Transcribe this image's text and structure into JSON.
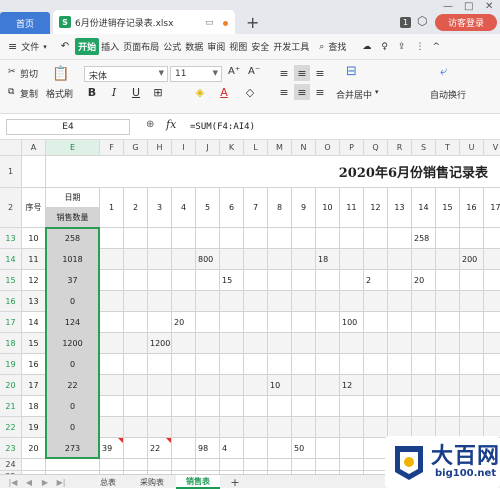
{
  "titlebar": {
    "home_tab": "首页",
    "file_tab": "6月份进销存记录表.xlsx",
    "file_icon": "S",
    "window_icon": "▭",
    "new_tab": "+",
    "badge": "1",
    "cube": "⬡",
    "login": "访客登录",
    "controls": [
      "—",
      "□",
      "✕"
    ]
  },
  "menubar": {
    "hamburger": "≡",
    "file": "文件",
    "tabs": [
      "开始",
      "插入",
      "页面布局",
      "公式",
      "数据",
      "审阅",
      "视图",
      "安全",
      "开发工具"
    ],
    "active_tab": "开始",
    "search": "查找",
    "right_icons": [
      "☁",
      "♀",
      "⇪",
      "⋮",
      "^"
    ]
  },
  "ribbon": {
    "cut": "剪切",
    "copy": "复制",
    "paste": "粘贴",
    "format_painter": "格式刷",
    "font_name": "宋体",
    "font_size": "11",
    "font_grow": "A⁺",
    "font_shrink": "A⁻",
    "bold": "B",
    "italic": "I",
    "underline": "U",
    "merge_center": "合并居中",
    "wrap_text": "自动换行",
    "align_icons": [
      "≡",
      "≡",
      "≡",
      "≡",
      "≡",
      "≡"
    ],
    "border_icon": "⊞",
    "fill_icon": "◈",
    "font_color_icon": "A",
    "eraser_icon": "◇"
  },
  "formula_bar": {
    "cell_ref": "E4",
    "zoom_icon": "⊕",
    "fx": "fx",
    "formula": "=SUM(F4:AI4)"
  },
  "columns": [
    "A",
    "E",
    "F",
    "G",
    "H",
    "I",
    "J",
    "K",
    "L",
    "M",
    "N",
    "O",
    "P",
    "Q",
    "R",
    "S",
    "T",
    "U",
    "V"
  ],
  "row_numbers": [
    "1",
    "2",
    "13",
    "14",
    "15",
    "16",
    "17",
    "18",
    "19",
    "20",
    "21",
    "22",
    "23",
    "24",
    "25"
  ],
  "sheet_title": "2020年6月份销售记录表",
  "header": {
    "seq": "序号",
    "date": "日期",
    "sales_qty": "销售数量",
    "days": [
      "1",
      "2",
      "3",
      "4",
      "5",
      "6",
      "7",
      "8",
      "9",
      "10",
      "11",
      "12",
      "13",
      "14",
      "15",
      "16",
      "17"
    ]
  },
  "rows": [
    {
      "rn": "13",
      "seq": "10",
      "total": "258",
      "cells": {
        "14": "258"
      }
    },
    {
      "rn": "14",
      "seq": "11",
      "total": "1018",
      "cells": {
        "5": "800",
        "10": "18",
        "16": "200"
      }
    },
    {
      "rn": "15",
      "seq": "12",
      "total": "37",
      "cells": {
        "6": "15",
        "12": "2",
        "14": "20"
      }
    },
    {
      "rn": "16",
      "seq": "13",
      "total": "0",
      "cells": {}
    },
    {
      "rn": "17",
      "seq": "14",
      "total": "124",
      "cells": {
        "4": "20",
        "11": "100"
      }
    },
    {
      "rn": "18",
      "seq": "15",
      "total": "1200",
      "cells": {
        "3": "1200"
      }
    },
    {
      "rn": "19",
      "seq": "16",
      "total": "0",
      "cells": {}
    },
    {
      "rn": "20",
      "seq": "17",
      "total": "22",
      "cells": {
        "8": "10",
        "11": "12"
      }
    },
    {
      "rn": "21",
      "seq": "18",
      "total": "0",
      "cells": {}
    },
    {
      "rn": "22",
      "seq": "19",
      "total": "0",
      "cells": {}
    },
    {
      "rn": "23",
      "seq": "20",
      "total": "273",
      "cells": {
        "1": "39",
        "3": "22",
        "5": "98",
        "6": "4",
        "9": "50"
      }
    },
    {
      "rn": "24",
      "seq": "",
      "total": "",
      "cells": {}
    },
    {
      "rn": "25",
      "seq": "",
      "total": "",
      "cells": {}
    }
  ],
  "sheet_tabs": [
    "总表",
    "采购表",
    "销售表"
  ],
  "active_sheet": "销售表",
  "sheet_nav": [
    "|◀",
    "◀",
    "▶",
    "▶|"
  ],
  "sheet_add": "+",
  "watermark": {
    "title": "大百网",
    "url": "big100.net"
  },
  "colors": {
    "accent": "#21a366",
    "home_tab": "#3f7ad6",
    "login": "#e05a4e",
    "selection": "#2b9e55"
  }
}
